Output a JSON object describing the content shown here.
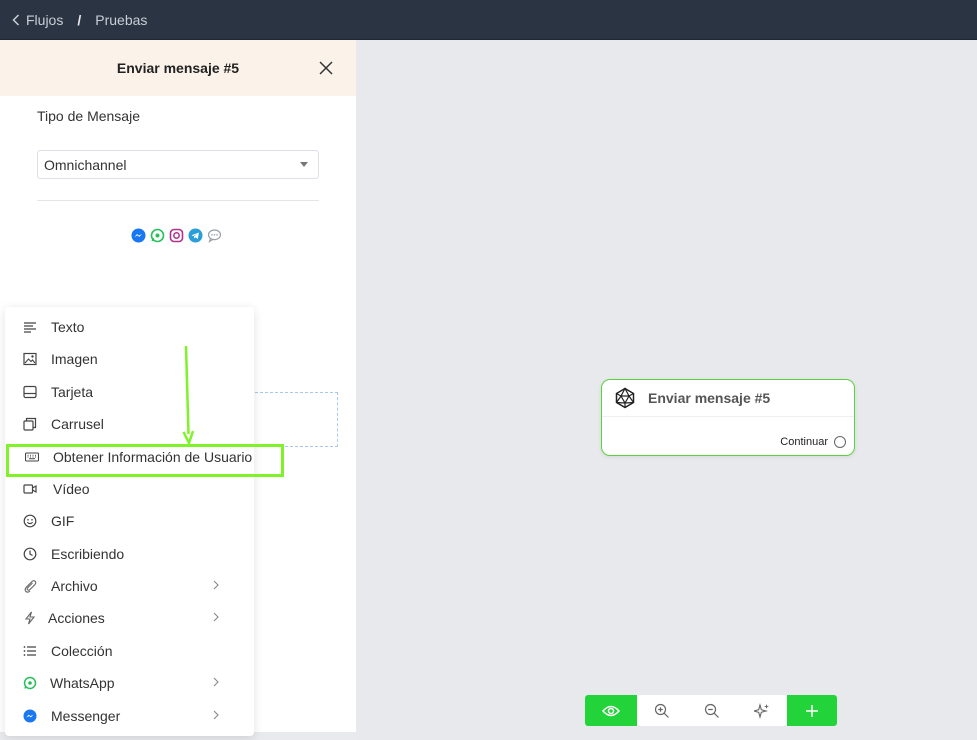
{
  "topbar": {
    "crumb_back": "Flujos",
    "separator": "/",
    "crumb_current": "Pruebas"
  },
  "panel": {
    "title": "Enviar mensaje #5",
    "message_type_label": "Tipo de Mensaje",
    "message_type_value": "Omnichannel",
    "channels": [
      "messenger-icon",
      "whatsapp-icon",
      "instagram-icon",
      "telegram-icon",
      "webchat-icon"
    ]
  },
  "menu": {
    "items": [
      {
        "label": "Texto",
        "icon": "text-lines-icon"
      },
      {
        "label": "Imagen",
        "icon": "image-icon"
      },
      {
        "label": "Tarjeta",
        "icon": "card-icon"
      },
      {
        "label": "Carrusel",
        "icon": "carousel-icon"
      },
      {
        "label": "Obtener Información de Usuario",
        "icon": "keyboard-icon"
      },
      {
        "label": "Vídeo",
        "icon": "video-icon"
      },
      {
        "label": "GIF",
        "icon": "smiley-icon"
      },
      {
        "label": "Escribiendo",
        "icon": "clock-icon"
      },
      {
        "label": "Archivo",
        "icon": "paperclip-icon",
        "submenu": true
      },
      {
        "label": "Acciones",
        "icon": "lightning-icon",
        "submenu": true
      },
      {
        "label": "Colección",
        "icon": "list-icon"
      },
      {
        "label": "WhatsApp",
        "icon": "whatsapp-icon",
        "submenu": true
      },
      {
        "label": "Messenger",
        "icon": "messenger-icon",
        "submenu": true
      }
    ]
  },
  "node": {
    "title": "Enviar mensaje #5",
    "output_label": "Continuar"
  },
  "toolbar": {
    "buttons": [
      "eye-icon",
      "zoom-in-icon",
      "zoom-out-icon",
      "sparkle-icon",
      "plus-icon"
    ]
  },
  "colors": {
    "accent_green": "#22d33a",
    "highlight": "#7ff22a",
    "topbar": "#2b3442",
    "panel_header": "#fbf3ea"
  }
}
